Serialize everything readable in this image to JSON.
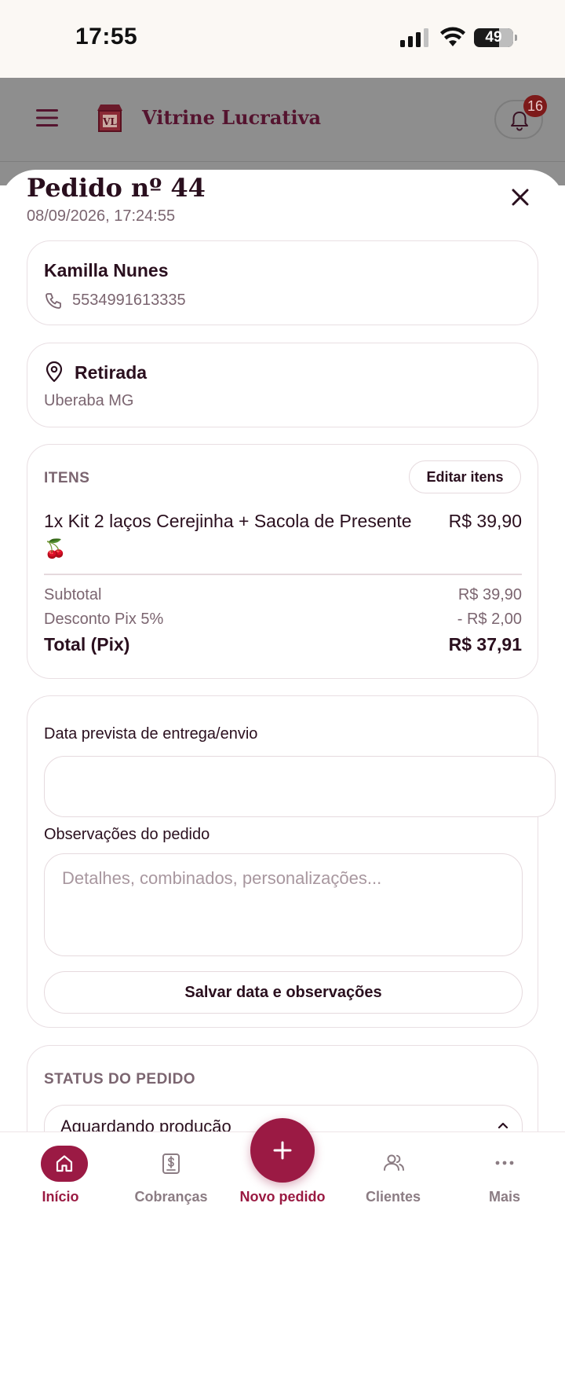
{
  "status_bar": {
    "time": "17:55",
    "battery": "49"
  },
  "app_header": {
    "brand": "Vitrine Lucrativa",
    "logo_monogram": "VL",
    "notification_count": "16"
  },
  "order": {
    "title": "Pedido nº 44",
    "datetime": "08/09/2026, 17:24:55",
    "customer": {
      "name": "Kamilla Nunes",
      "phone": "5534991613335"
    },
    "delivery": {
      "method": "Retirada",
      "city": "Uberaba MG"
    },
    "items_section": {
      "label": "ITENS",
      "edit_label": "Editar itens",
      "items": [
        {
          "name": "1x Kit 2 laços Cerejinha + Sacola de Presente 🍒",
          "price": "R$ 39,90"
        }
      ],
      "subtotal_label": "Subtotal",
      "subtotal_value": "R$ 39,90",
      "discount_label": "Desconto Pix 5%",
      "discount_value": "- R$ 2,00",
      "total_label": "Total (Pix)",
      "total_value": "R$ 37,91"
    },
    "notes_section": {
      "date_label": "Data prevista de entrega/envio",
      "date_value": "",
      "notes_label": "Observações do pedido",
      "notes_placeholder": "Detalhes, combinados, personalizações...",
      "save_label": "Salvar data e observações"
    },
    "status_section": {
      "label": "STATUS DO PEDIDO",
      "selected": "Aguardando produção"
    }
  },
  "tabbar": {
    "tabs": [
      {
        "label": "Início",
        "icon": "home-icon",
        "active": true
      },
      {
        "label": "Cobranças",
        "icon": "dollar-doc-icon",
        "active": false
      },
      {
        "label": "Novo pedido",
        "icon": "plus-icon",
        "active": false
      },
      {
        "label": "Clientes",
        "icon": "users-icon",
        "active": false
      },
      {
        "label": "Mais",
        "icon": "more-icon",
        "active": false
      }
    ]
  },
  "colors": {
    "accent": "#9b1a44",
    "text": "#2a0f1e",
    "muted": "#7b6570"
  }
}
